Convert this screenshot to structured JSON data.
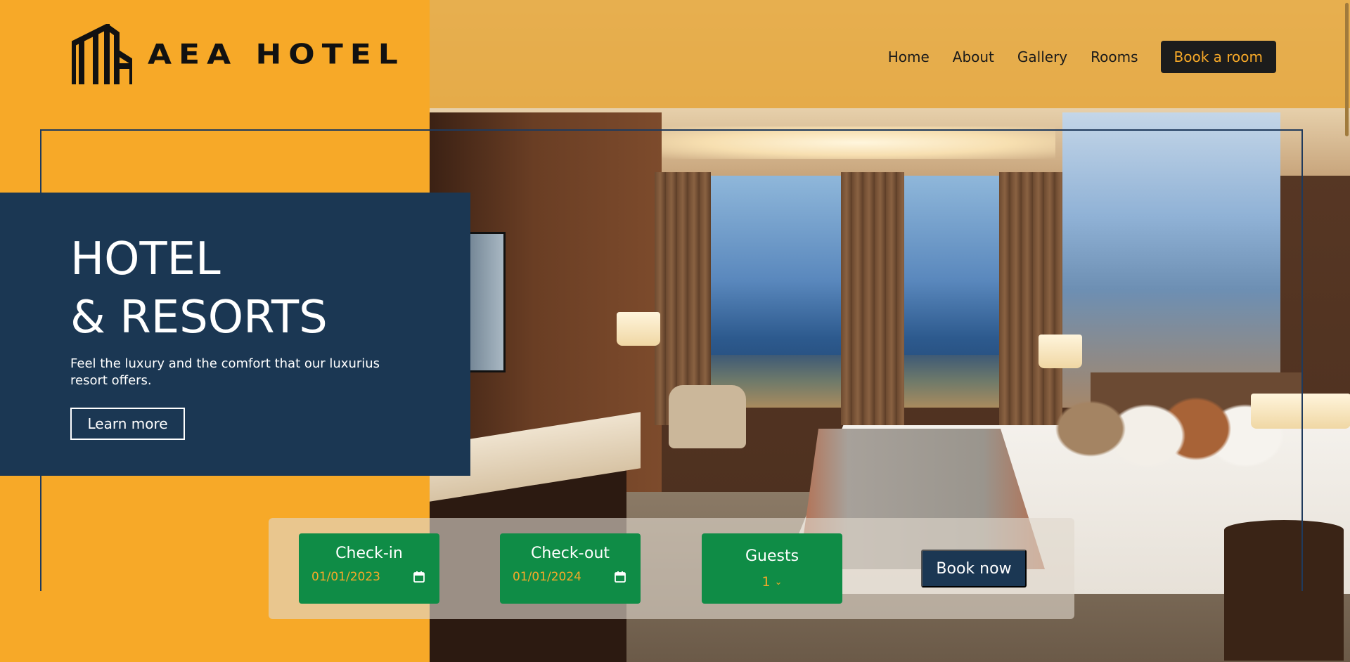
{
  "brand": {
    "name": "AEA HOTEL",
    "logo_icon": "building-icon"
  },
  "nav": {
    "items": [
      {
        "label": "Home"
      },
      {
        "label": "About"
      },
      {
        "label": "Gallery"
      },
      {
        "label": "Rooms"
      }
    ],
    "cta": "Book a room"
  },
  "hero": {
    "title_line1": "HOTEL",
    "title_line2": "& RESORTS",
    "subtitle": "Feel the luxury and the comfort that our luxurius resort offers.",
    "button": "Learn more"
  },
  "booking": {
    "checkin": {
      "label": "Check-in",
      "value": "01/01/2023",
      "icon": "calendar-icon"
    },
    "checkout": {
      "label": "Check-out",
      "value": "01/01/2024",
      "icon": "calendar-icon"
    },
    "guests": {
      "label": "Guests",
      "value": "1",
      "icon": "chevron-down-icon"
    },
    "button": "Book now"
  },
  "colors": {
    "orange": "#f7a928",
    "navy": "#1b3753",
    "green": "#0f8c46",
    "dark": "#1c1c1c"
  }
}
